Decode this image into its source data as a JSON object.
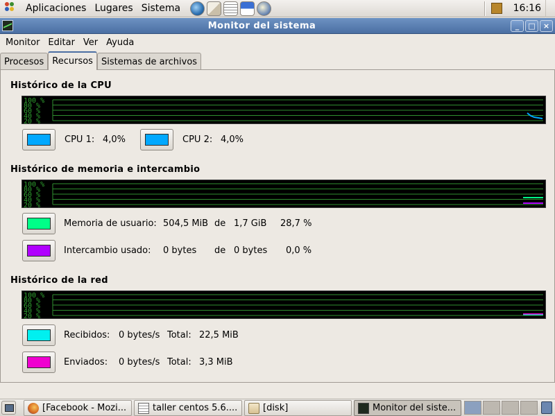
{
  "top_panel": {
    "menus": [
      "Aplicaciones",
      "Lugares",
      "Sistema"
    ],
    "launchers": [
      "network-globe-icon",
      "mail-icon",
      "text-editor-icon",
      "document-edit-icon",
      "help-globe-icon"
    ],
    "clock": "16:16"
  },
  "window": {
    "title": "Monitor del sistema",
    "controls": [
      "_",
      "□",
      "×"
    ]
  },
  "menubar": [
    "Monitor",
    "Editar",
    "Ver",
    "Ayuda"
  ],
  "tabs": [
    {
      "label": "Procesos",
      "active": false
    },
    {
      "label": "Recursos",
      "active": true
    },
    {
      "label": "Sistemas de archivos",
      "active": false
    }
  ],
  "graph_axis_labels": [
    "100 %",
    "80 %",
    "60 %",
    "40 %",
    "20 %"
  ],
  "cpu": {
    "title": "Histórico de la CPU",
    "cpu1": {
      "label": "CPU 1:",
      "value": "4,0%",
      "color": "#00a8ff"
    },
    "cpu2": {
      "label": "CPU 2:",
      "value": "4,0%",
      "color": "#00a8ff"
    }
  },
  "memory": {
    "title": "Histórico de memoria e intercambio",
    "user_mem": {
      "label": "Memoria de usuario:",
      "used": "504,5 MiB",
      "of": "de",
      "total": "1,7 GiB",
      "percent": "28,7 %",
      "color": "#00ff88"
    },
    "swap": {
      "label": "Intercambio usado:",
      "used": "0 bytes",
      "of": "de",
      "total": "0 bytes",
      "percent": "0,0 %",
      "color": "#b000ff"
    }
  },
  "network": {
    "title": "Histórico de la red",
    "received": {
      "label": "Recibidos:",
      "rate": "0 bytes/s",
      "total_label": "Total:",
      "total": "22,5 MiB",
      "color": "#00f0f0"
    },
    "sent": {
      "label": "Enviados:",
      "rate": "0 bytes/s",
      "total_label": "Total:",
      "total": "3,3 MiB",
      "color": "#f000d0"
    }
  },
  "taskbar": {
    "tasks": [
      {
        "label": "[Facebook - Mozi...",
        "icon": "firefox-icon",
        "active": false
      },
      {
        "label": "taller centos 5.6....",
        "icon": "document-icon",
        "active": false
      },
      {
        "label": "[disk]",
        "icon": "folder-icon",
        "active": false
      },
      {
        "label": "Monitor del siste...",
        "icon": "system-monitor-icon",
        "active": true
      }
    ]
  }
}
